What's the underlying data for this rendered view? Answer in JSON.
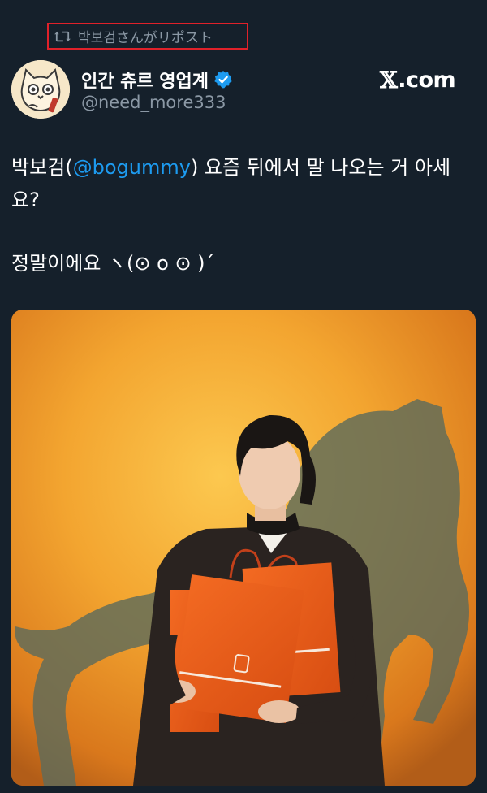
{
  "repost": {
    "text": "박보검さんがリポスト",
    "icon": "repost-icon",
    "highlight_color": "#e0212a"
  },
  "author": {
    "display_name": "인간 츄르 영업계",
    "handle": "@need_more333",
    "verified": true,
    "avatar_icon": "cat-avatar"
  },
  "brand": {
    "label": ".com",
    "logo": "x-logo"
  },
  "tweet": {
    "line1_prefix": "박보검(",
    "mention": "@bogummy",
    "line1_suffix": ") 요즘 뒤에서 말 나오는 거 아세요?",
    "line2": "정말이에요 ヽ(⊙ o ⊙ )ˊ"
  },
  "media": {
    "alt_icon": "photo-man-with-orange-bags"
  },
  "colors": {
    "background": "#15202b",
    "text": "#ffffff",
    "secondary": "#8b98a5",
    "accent": "#1d9bf0"
  }
}
